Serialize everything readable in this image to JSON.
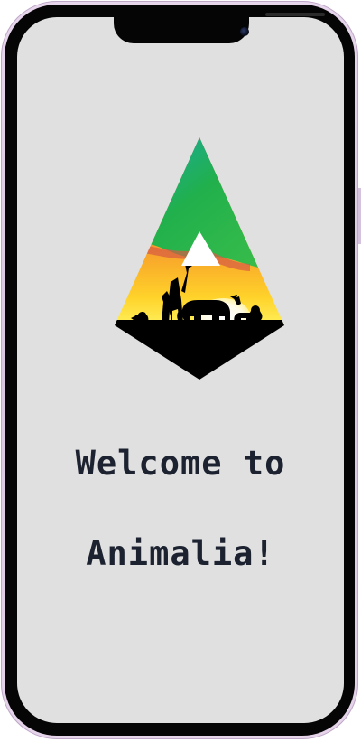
{
  "screen": {
    "background": "#e0e0e0"
  },
  "device": {
    "frame_color": "#dccbe4",
    "bezel_color": "#050505"
  },
  "logo": {
    "icon": "animalia-safari-triangle-logo",
    "colors": {
      "green": "#22b04b",
      "teal": "#1aa8a8",
      "orange": "#f08a2c",
      "yellow": "#ffd72a",
      "red": "#d95a3e",
      "black": "#000000"
    }
  },
  "welcome": {
    "line1": "Welcome to",
    "line2": "Animalia!"
  }
}
